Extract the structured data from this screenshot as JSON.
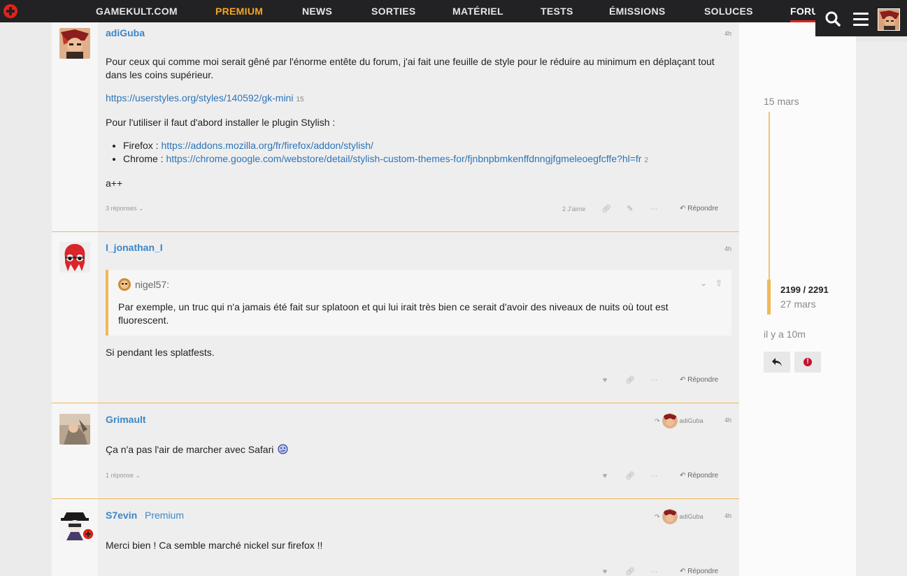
{
  "nav": {
    "items": [
      {
        "label": "GAMEKULT.COM",
        "kind": "normal"
      },
      {
        "label": "PREMIUM",
        "kind": "premium"
      },
      {
        "label": "NEWS",
        "kind": "normal"
      },
      {
        "label": "SORTIES",
        "kind": "normal"
      },
      {
        "label": "MATÉRIEL",
        "kind": "normal"
      },
      {
        "label": "TESTS",
        "kind": "normal"
      },
      {
        "label": "ÉMISSIONS",
        "kind": "normal"
      },
      {
        "label": "SOLUCES",
        "kind": "normal"
      },
      {
        "label": "FORU",
        "kind": "active"
      }
    ],
    "colors": {
      "premium": "#f5a623",
      "active_bar": "#e2231a",
      "bg": "#222224"
    }
  },
  "posts": [
    {
      "username": "adiGuba",
      "time": "4h",
      "body": {
        "p1": "Pour ceux qui comme moi serait gêné par l'énorme entête du forum, j'ai fait une feuille de style pour le réduire au minimum en déplaçant tout dans les coins supérieur.",
        "link1": "https://userstyles.org/styles/140592/gk-mini",
        "link1_clicks": "15",
        "p2": "Pour l'utiliser il faut d'abord installer le plugin Stylish :",
        "li1_prefix": "Firefox : ",
        "li1_link": "https://addons.mozilla.org/fr/firefox/addon/stylish/",
        "li2_prefix": "Chrome : ",
        "li2_link": "https://chrome.google.com/webstore/detail/stylish-custom-themes-for/fjnbnpbmkenffdnngjfgmeleoegfcffe?hl=fr",
        "li2_clicks": "2",
        "p3": "a++"
      },
      "replies": "3 réponses",
      "likes": "2 J'aime",
      "reply_label": "Répondre"
    },
    {
      "username": "I_jonathan_I",
      "time": "4h",
      "quote": {
        "author": "nigel57:",
        "text": "Par exemple, un truc qui n'a jamais été fait sur splatoon et qui lui irait très bien ce serait d'avoir des niveaux de nuits où tout est fluorescent."
      },
      "body": "Si pendant les splatfests.",
      "reply_label": "Répondre"
    },
    {
      "username": "Grimault",
      "time": "4h",
      "reply_to": "adiGuba",
      "body": "Ça n'a pas l'air de marcher avec Safari",
      "emoji": "confused-face",
      "replies": "1 réponse",
      "reply_label": "Répondre"
    },
    {
      "username": "S7evin",
      "user_title": "Premium",
      "time": "4h",
      "reply_to": "adiGuba",
      "body": "Merci bien ! Ca semble marché nickel sur firefox !!",
      "reply_label": "Répondre"
    }
  ],
  "timeline": {
    "start_date": "15 mars",
    "progress": "2199 / 2291",
    "current_date": "27 mars",
    "end_label": "il y a 10m",
    "accent": "#f0b858"
  }
}
